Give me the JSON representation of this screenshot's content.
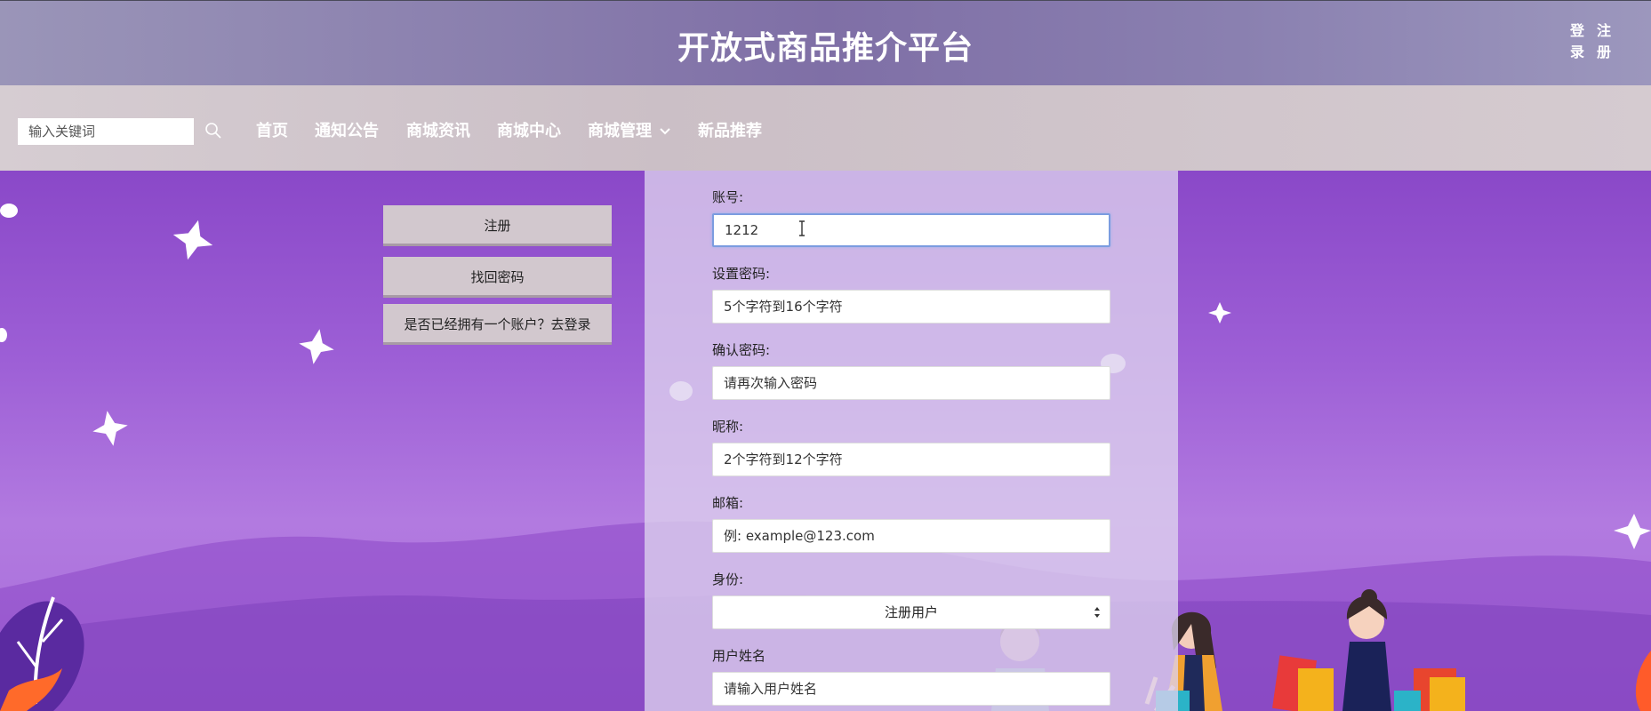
{
  "header": {
    "title": "开放式商品推介平台",
    "login_label": "登录",
    "register_label": "注册"
  },
  "nav": {
    "search_placeholder": "输入关键词",
    "items": [
      "首页",
      "通知公告",
      "商城资讯",
      "商城中心",
      "商城管理",
      "新品推荐"
    ]
  },
  "side": {
    "register_btn": "注册",
    "recover_btn": "找回密码",
    "login_btn": "是否已经拥有一个账户？去登录"
  },
  "form": {
    "account_label": "账号:",
    "account_value": "1212",
    "password_label": "设置密码:",
    "password_placeholder": "5个字符到16个字符",
    "confirm_label": "确认密码:",
    "confirm_placeholder": "请再次输入密码",
    "nickname_label": "昵称:",
    "nickname_placeholder": "2个字符到12个字符",
    "email_label": "邮箱:",
    "email_placeholder": "例: example@123.com",
    "identity_label": "身份:",
    "identity_value": "注册用户",
    "username_label": "用户姓名",
    "username_placeholder": "请输入用户姓名"
  },
  "colors": {
    "header_bg": "#8a7fae",
    "nav_bg": "#cbbfc6",
    "main_bg": "#9d5fd6",
    "focus_border": "#7b9ce0"
  }
}
